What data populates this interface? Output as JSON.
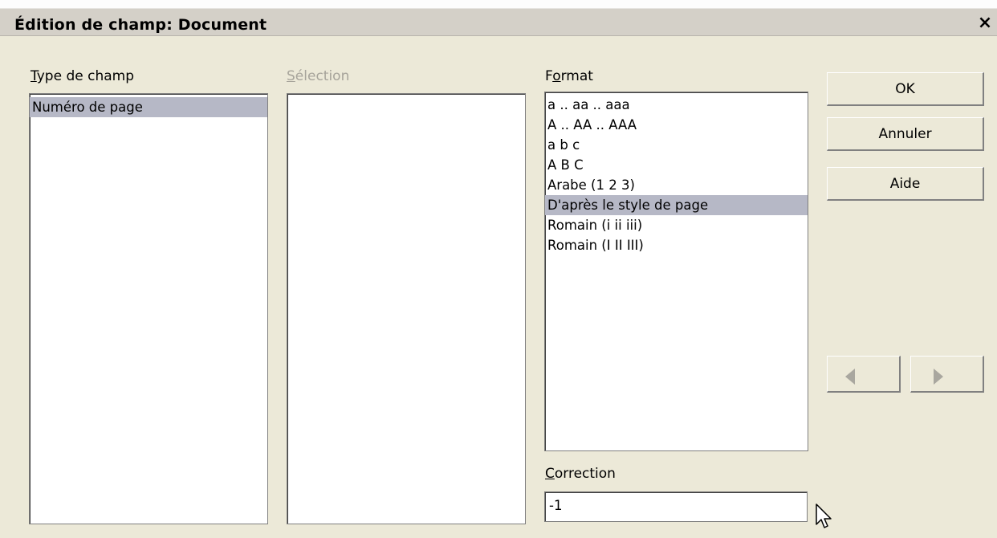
{
  "dialog": {
    "title": "Édition de champ: Document",
    "close_glyph": "×"
  },
  "type_de_champ": {
    "label_key": "T",
    "label_rest": "ype de champ",
    "items": [
      {
        "label": "Numéro de page",
        "selected": true
      }
    ]
  },
  "selection": {
    "label_key": "S",
    "label_rest": "élection",
    "items": []
  },
  "format": {
    "label_pre": "F",
    "label_key": "o",
    "label_post": "rmat",
    "items": [
      {
        "label": "a .. aa .. aaa",
        "selected": false
      },
      {
        "label": "A .. AA .. AAA",
        "selected": false
      },
      {
        "label": "a b c",
        "selected": false
      },
      {
        "label": "A B C",
        "selected": false
      },
      {
        "label": "Arabe (1 2 3)",
        "selected": false
      },
      {
        "label": "D'après le style de page",
        "selected": true
      },
      {
        "label": "Romain (i ii iii)",
        "selected": false
      },
      {
        "label": "Romain (I II III)",
        "selected": false
      }
    ]
  },
  "correction": {
    "label_key": "C",
    "label_rest": "orrection",
    "value": "-1"
  },
  "buttons": {
    "ok": "OK",
    "cancel": "Annuler",
    "help": "Aide"
  },
  "nav": {
    "prev_icon": "triangle-left-icon",
    "next_icon": "triangle-right-icon",
    "disabled": true
  },
  "colors": {
    "dialog_bg": "#ece9d8",
    "selection_highlight": "#b6b8c6",
    "disabled_text": "#a7a49b"
  }
}
